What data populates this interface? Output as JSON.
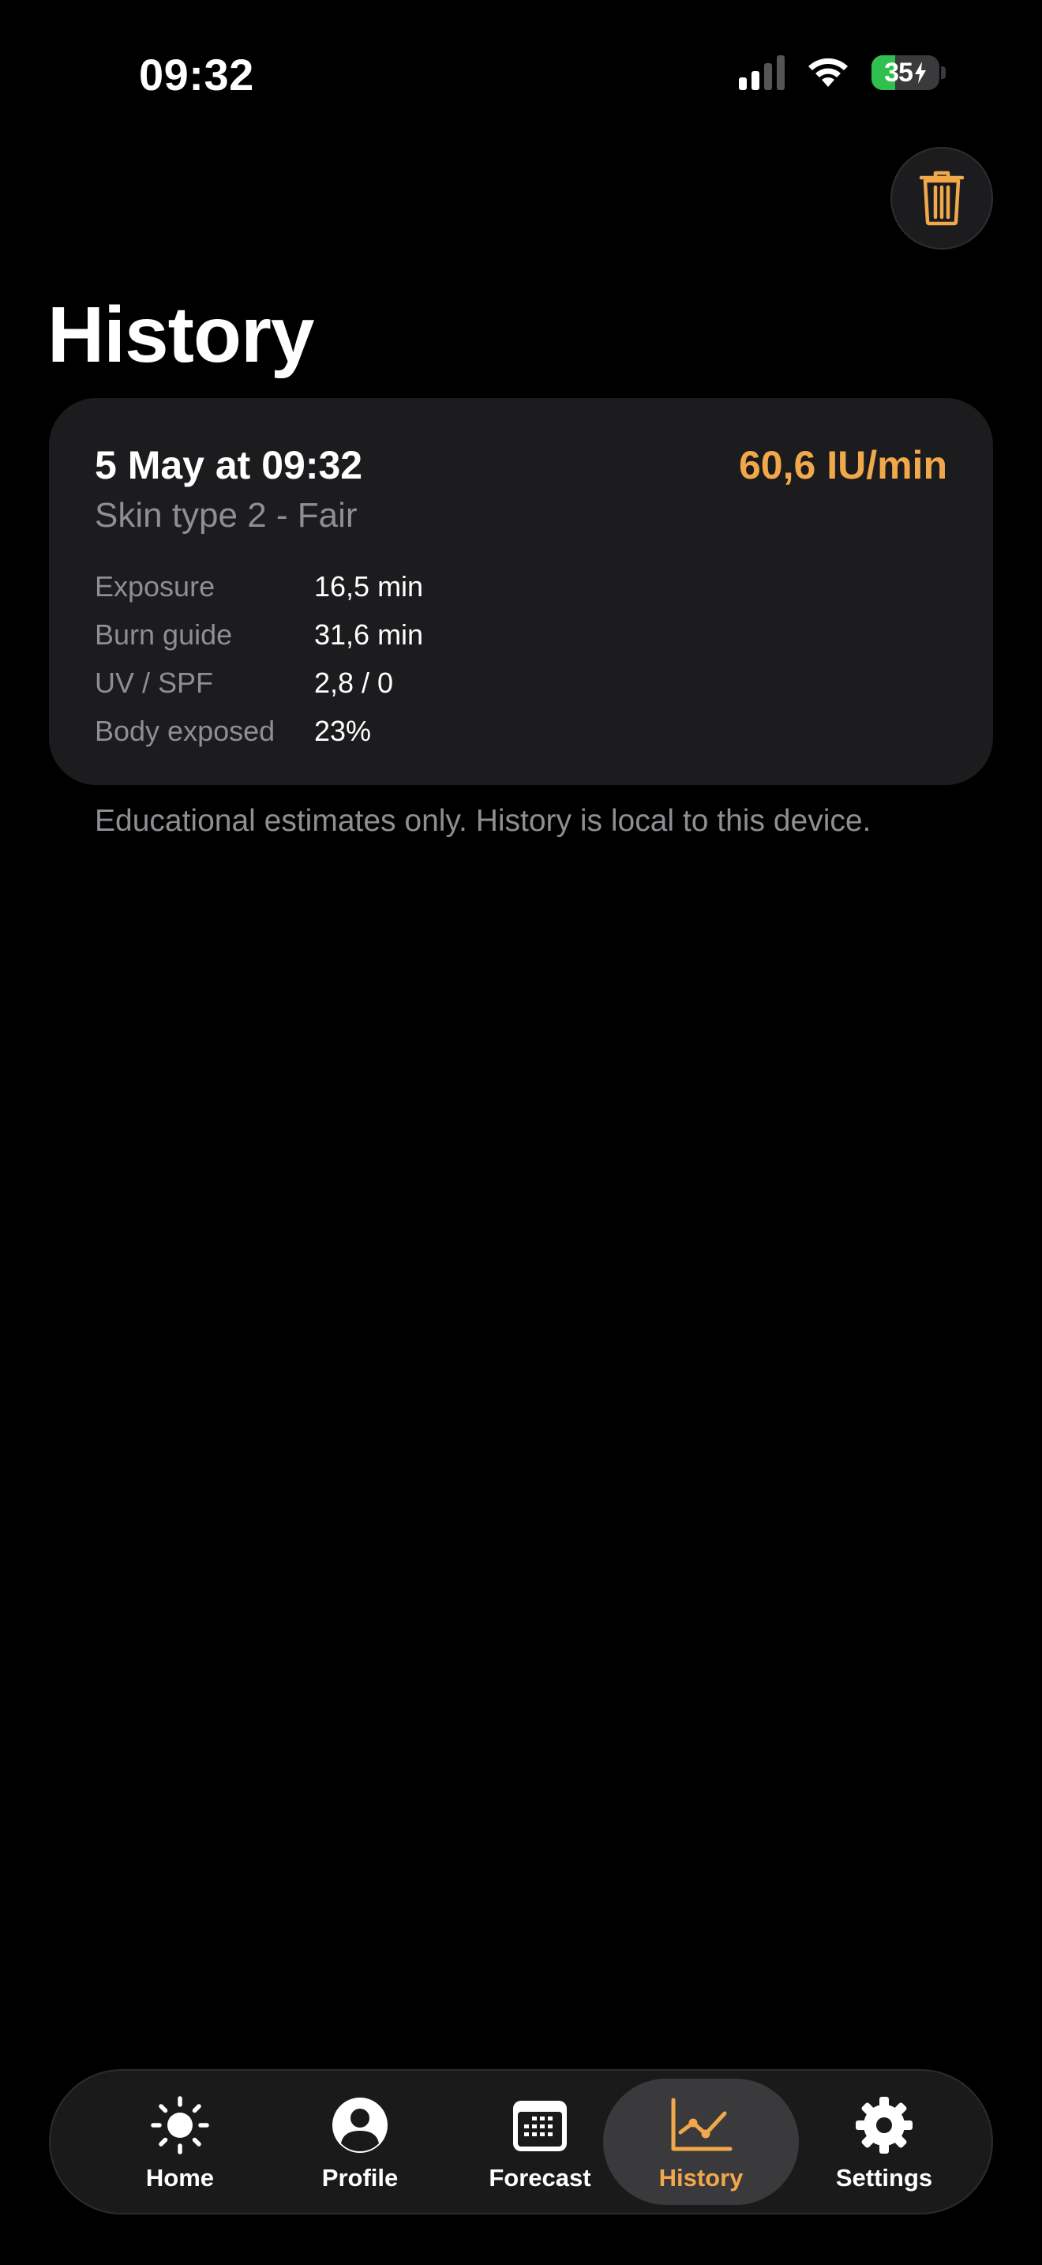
{
  "status_bar": {
    "time": "09:32",
    "battery_percent": "35",
    "battery_level": 0.35
  },
  "header": {
    "title": "History",
    "trash_icon": "trash-icon"
  },
  "entries": [
    {
      "date": "5 May at 09:32",
      "rate": "60,6 IU/min",
      "skin_type": "Skin type 2 - Fair",
      "stats": [
        {
          "label": "Exposure",
          "value": "16,5 min"
        },
        {
          "label": "Burn guide",
          "value": "31,6 min"
        },
        {
          "label": "UV / SPF",
          "value": "2,8 / 0"
        },
        {
          "label": "Body exposed",
          "value": "23%"
        }
      ]
    }
  ],
  "footnote": "Educational estimates only. History is local to this device.",
  "tabbar": {
    "tabs": [
      {
        "label": "Home",
        "icon": "sun-icon"
      },
      {
        "label": "Profile",
        "icon": "person-icon"
      },
      {
        "label": "Forecast",
        "icon": "calendar-icon"
      },
      {
        "label": "History",
        "icon": "chart-line-icon",
        "active": true
      },
      {
        "label": "Settings",
        "icon": "gear-icon"
      }
    ]
  },
  "colors": {
    "accent": "#f0a84a",
    "background": "#000000",
    "card": "#1c1c1e",
    "secondary_text": "#8e8e93",
    "battery_green": "#30c04f"
  }
}
